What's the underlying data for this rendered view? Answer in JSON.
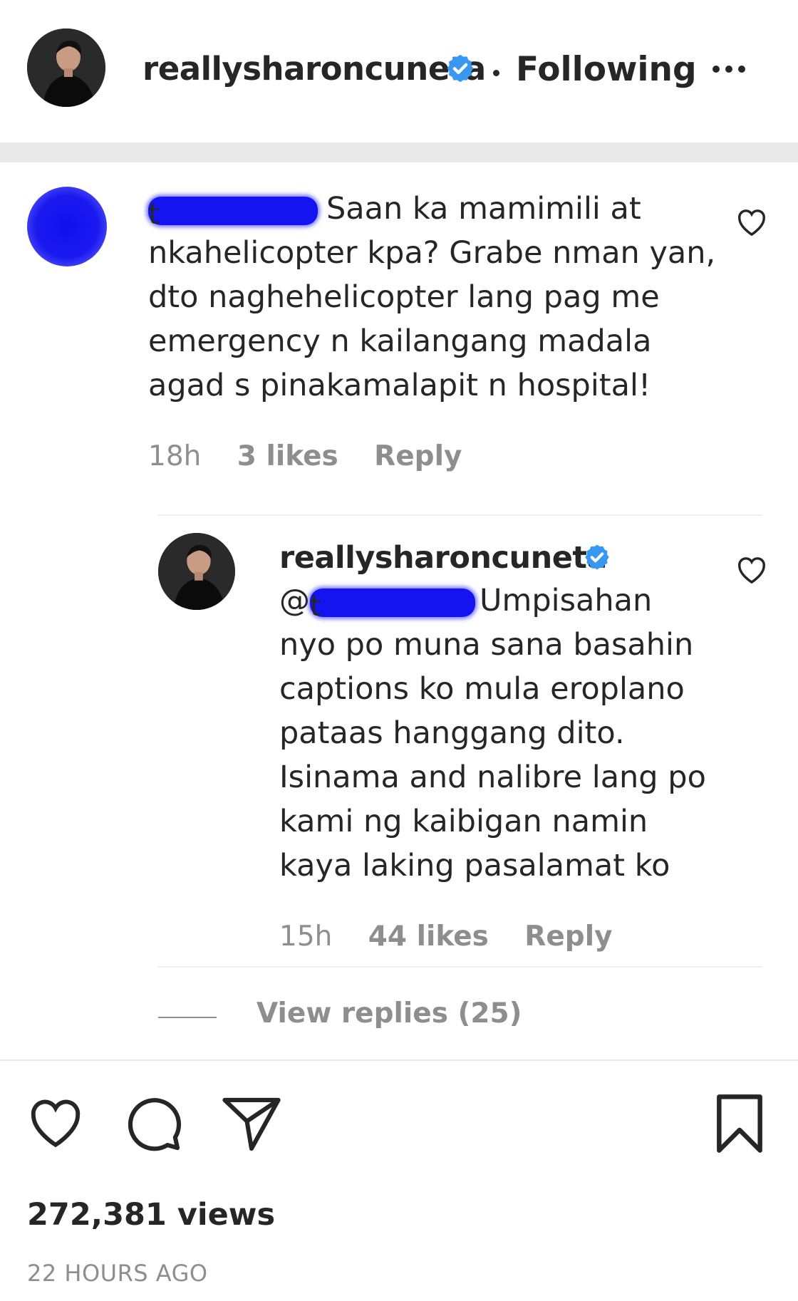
{
  "header": {
    "username": "reallysharoncuneta",
    "follow_status": "Following"
  },
  "comment": {
    "text_lines": [
      "Saan ka mamimili at",
      "nkahelicopter kpa? Grabe nman yan,",
      "dto naghehelicopter lang pag me",
      "emergency n kailangang madala",
      "agad s pinakamalapit n hospital!"
    ],
    "time": "18h",
    "likes": "3 likes",
    "reply_label": "Reply"
  },
  "reply": {
    "username": "reallysharoncuneta",
    "mention_prefix": "@",
    "text_lines": [
      "Umpisahan",
      "nyo po muna sana basahin",
      "captions ko mula eroplano",
      "pataas hanggang dito.",
      "Isinama and nalibre lang po",
      "kami ng kaibigan namin",
      "kaya laking pasalamat ko"
    ],
    "time": "15h",
    "likes": "44 likes",
    "reply_label": "Reply"
  },
  "view_replies": "View replies (25)",
  "footer": {
    "views": "272,381 views",
    "posted": "22 HOURS AGO"
  },
  "colors": {
    "verified": "#3897f0",
    "redaction": "#1414f0",
    "meta_text": "#8e8e8e"
  },
  "icons": [
    "verified-badge-icon",
    "more-options-icon",
    "heart-icon",
    "comment-icon",
    "share-icon",
    "bookmark-icon"
  ]
}
